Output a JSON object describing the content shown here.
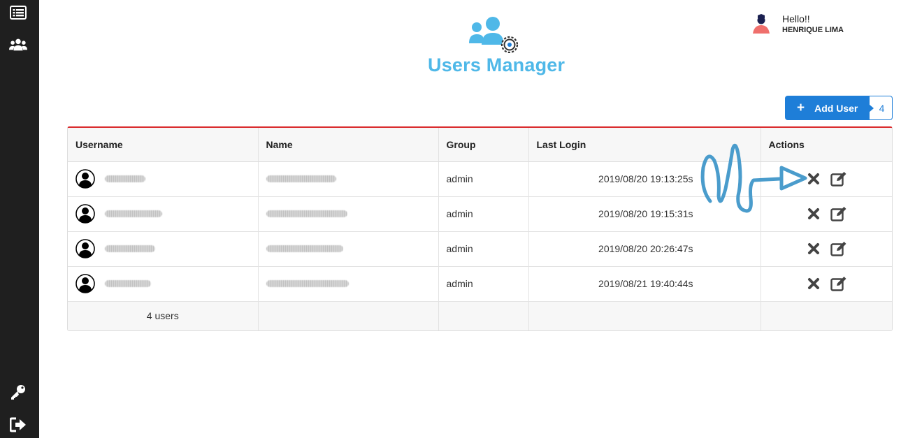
{
  "sidebar": {
    "items": [
      {
        "icon": "list-icon"
      },
      {
        "icon": "users-icon"
      },
      {
        "icon": "key-icon"
      },
      {
        "icon": "logout-icon"
      }
    ]
  },
  "header": {
    "title": "Users Manager",
    "logo_icon": "users-gear-icon"
  },
  "user": {
    "greeting": "Hello!!",
    "name": "HENRIQUE LIMA"
  },
  "add_user": {
    "label": "Add User",
    "count": "4"
  },
  "table": {
    "columns": [
      "Username",
      "Name",
      "Group",
      "Last Login",
      "Actions"
    ],
    "rows": [
      {
        "username": "",
        "name": "",
        "group": "admin",
        "last_login": "2019/08/20 19:13:25s"
      },
      {
        "username": "",
        "name": "",
        "group": "admin",
        "last_login": "2019/08/20 19:15:31s"
      },
      {
        "username": "",
        "name": "",
        "group": "admin",
        "last_login": "2019/08/20 20:26:47s"
      },
      {
        "username": "",
        "name": "",
        "group": "admin",
        "last_login": "2019/08/21 19:40:44s"
      }
    ],
    "footer": "4 users"
  },
  "colors": {
    "accent": "#4fb8e8",
    "button": "#1e7ed8",
    "table_top_border": "#d9292c",
    "sidebar": "#1f1f1f"
  }
}
